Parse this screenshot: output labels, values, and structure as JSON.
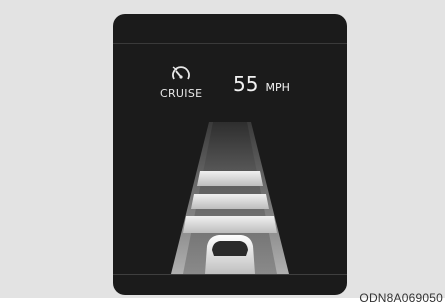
{
  "cluster": {
    "cruise_label": "CRUISE",
    "speed_value": "55",
    "speed_unit": "MPH",
    "cruise_icon": "cruise-control-speedometer-icon"
  },
  "caption": "ODN8A069050",
  "colors": {
    "screen": "#1b1b1b",
    "panel": "#e3e3e3",
    "road": "#6e6e6e",
    "lane_bar": "#d9d9d9"
  }
}
